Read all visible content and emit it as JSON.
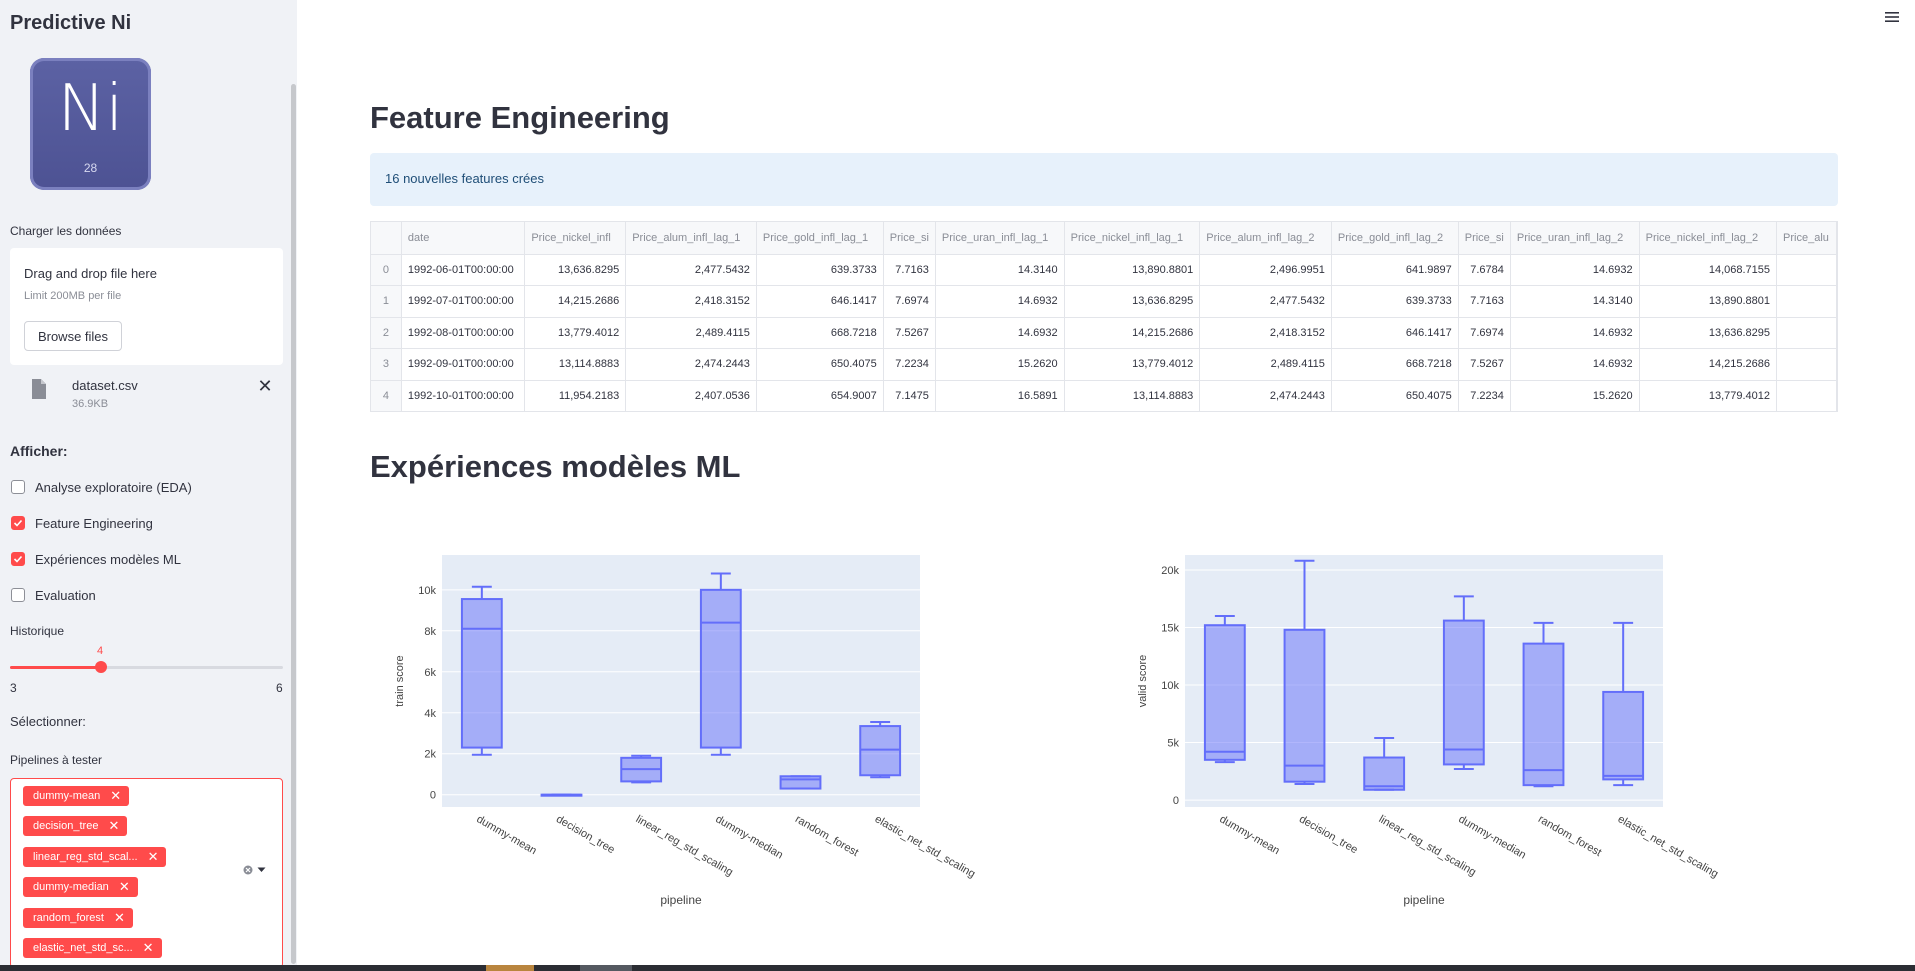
{
  "sidebar": {
    "app_title": "Predictive Ni",
    "logo": {
      "symbol": "Ni",
      "number": "28"
    },
    "upload_label": "Charger les données",
    "uploader": {
      "title": "Drag and drop file here",
      "limit": "Limit 200MB per file",
      "browse": "Browse files"
    },
    "file": {
      "name": "dataset.csv",
      "size": "36.9KB",
      "close": "✕"
    },
    "afficher_label": "Afficher:",
    "checkboxes": [
      {
        "label": "Analyse exploratoire (EDA)",
        "checked": false
      },
      {
        "label": "Feature Engineering",
        "checked": true
      },
      {
        "label": "Expériences modèles ML",
        "checked": true
      },
      {
        "label": "Evaluation",
        "checked": false
      }
    ],
    "historique": {
      "label": "Historique",
      "value": "4",
      "min": "3",
      "max": "6",
      "fraction": 0.3333
    },
    "selectionner_label": "Sélectionner:",
    "pipelines_label": "Pipelines à tester",
    "pipelines": [
      {
        "label": "dummy-mean",
        "x": "✕"
      },
      {
        "label": "decision_tree",
        "x": "✕"
      },
      {
        "label": "linear_reg_std_scal...",
        "x": "✕"
      },
      {
        "label": "dummy-median",
        "x": "✕"
      },
      {
        "label": "random_forest",
        "x": "✕"
      },
      {
        "label": "elastic_net_std_sc...",
        "x": "✕"
      }
    ]
  },
  "main": {
    "feature_title": "Feature Engineering",
    "info": "16 nouvelles features crées",
    "table": {
      "headers": [
        "",
        "date",
        "Price_nickel_infl",
        "Price_alum_infl_lag_1",
        "Price_gold_infl_lag_1",
        "Price_si",
        "Price_uran_infl_lag_1",
        "Price_nickel_infl_lag_1",
        "Price_alum_infl_lag_2",
        "Price_gold_infl_lag_2",
        "Price_si",
        "Price_uran_infl_lag_2",
        "Price_nickel_infl_lag_2",
        "Price_alu"
      ],
      "rows": [
        [
          "0",
          "1992-06-01T00:00:00",
          "13,636.8295",
          "2,477.5432",
          "639.3733",
          "7.7163",
          "14.3140",
          "13,890.8801",
          "2,496.9951",
          "641.9897",
          "7.6784",
          "14.6932",
          "14,068.7155",
          ""
        ],
        [
          "1",
          "1992-07-01T00:00:00",
          "14,215.2686",
          "2,418.3152",
          "646.1417",
          "7.6974",
          "14.6932",
          "13,636.8295",
          "2,477.5432",
          "639.3733",
          "7.7163",
          "14.3140",
          "13,890.8801",
          ""
        ],
        [
          "2",
          "1992-08-01T00:00:00",
          "13,779.4012",
          "2,489.4115",
          "668.7218",
          "7.5267",
          "14.6932",
          "14,215.2686",
          "2,418.3152",
          "646.1417",
          "7.6974",
          "14.6932",
          "13,636.8295",
          ""
        ],
        [
          "3",
          "1992-09-01T00:00:00",
          "13,114.8883",
          "2,474.2443",
          "650.4075",
          "7.2234",
          "15.2620",
          "13,779.4012",
          "2,489.4115",
          "668.7218",
          "7.5267",
          "14.6932",
          "14,215.2686",
          ""
        ],
        [
          "4",
          "1992-10-01T00:00:00",
          "11,954.2183",
          "2,407.0536",
          "654.9007",
          "7.1475",
          "16.5891",
          "13,114.8883",
          "2,474.2443",
          "650.4075",
          "7.2234",
          "15.2620",
          "13,779.4012",
          ""
        ]
      ]
    },
    "ml_title": "Expériences modèles ML"
  },
  "chart_data": [
    {
      "type": "box",
      "xlabel": "pipeline",
      "ylabel": "train score",
      "ylim": [
        -600,
        11700
      ],
      "yticks": [
        0,
        2000,
        4000,
        6000,
        8000,
        10000
      ],
      "ytick_labels": [
        "0",
        "2k",
        "4k",
        "6k",
        "8k",
        "10k"
      ],
      "categories": [
        "dummy-mean",
        "decision_tree",
        "linear_reg_std_scaling",
        "dummy-median",
        "random_forest",
        "elastic_net_std_scaling"
      ],
      "boxes": [
        {
          "min": 1950,
          "q1": 2300,
          "median": 8100,
          "q3": 9550,
          "max": 10150
        },
        {
          "min": 0,
          "q1": 0,
          "median": 0,
          "q3": 0,
          "max": 0
        },
        {
          "min": 600,
          "q1": 650,
          "median": 1250,
          "q3": 1800,
          "max": 1900
        },
        {
          "min": 1950,
          "q1": 2300,
          "median": 8400,
          "q3": 10000,
          "max": 10800
        },
        {
          "min": 300,
          "q1": 300,
          "median": 750,
          "q3": 900,
          "max": 900
        },
        {
          "min": 850,
          "q1": 950,
          "median": 2200,
          "q3": 3350,
          "max": 3550
        }
      ],
      "color": "#636efa"
    },
    {
      "type": "box",
      "xlabel": "pipeline",
      "ylabel": "valid score",
      "ylim": [
        -600,
        21300
      ],
      "yticks": [
        0,
        5000,
        10000,
        15000,
        20000
      ],
      "ytick_labels": [
        "0",
        "5k",
        "10k",
        "15k",
        "20k"
      ],
      "categories": [
        "dummy-mean",
        "decision_tree",
        "linear_reg_std_scaling",
        "dummy-median",
        "random_forest",
        "elastic_net_std_scaling"
      ],
      "boxes": [
        {
          "min": 3300,
          "q1": 3500,
          "median": 4200,
          "q3": 15200,
          "max": 16000
        },
        {
          "min": 1400,
          "q1": 1600,
          "median": 3000,
          "q3": 14800,
          "max": 20800
        },
        {
          "min": 900,
          "q1": 900,
          "median": 1200,
          "q3": 3700,
          "max": 5400
        },
        {
          "min": 2700,
          "q1": 3100,
          "median": 4400,
          "q3": 15600,
          "max": 17700
        },
        {
          "min": 1200,
          "q1": 1300,
          "median": 2600,
          "q3": 13600,
          "max": 15400
        },
        {
          "min": 1300,
          "q1": 1800,
          "median": 2100,
          "q3": 9400,
          "max": 15400
        }
      ],
      "color": "#636efa"
    }
  ]
}
